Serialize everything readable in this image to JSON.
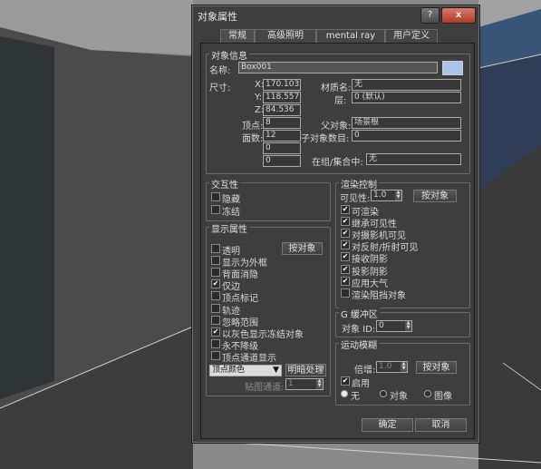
{
  "dialog": {
    "title": "对象属性",
    "help_label": "?",
    "close_label": "x"
  },
  "tabs": [
    "常规",
    "高级照明",
    "mental ray",
    "用户定义"
  ],
  "object_info": {
    "legend": "对象信息",
    "name_label": "名称:",
    "name_value": "Box001",
    "color": "#a9c3ec",
    "size_label": "尺寸:",
    "x_label": "X:",
    "x_value": "170.103",
    "y_label": "Y:",
    "y_value": "118.557",
    "z_label": "Z:",
    "z_value": "84.536",
    "material_label": "材质名:",
    "material_value": "无",
    "layer_label": "层:",
    "layer_value": "0 (默认)",
    "vertices_label": "顶点:",
    "vertices_value": "8",
    "faces_label": "面数:",
    "faces_value": "12",
    "extra_value_1": "0",
    "extra_value_2": "0",
    "parent_label": "父对象:",
    "parent_value": "场景根",
    "children_label": "子对象数目:",
    "children_value": "0",
    "group_label": "在组/集合中:",
    "group_value": "无"
  },
  "interactivity": {
    "legend": "交互性",
    "hide": "隐藏",
    "freeze": "冻结"
  },
  "display_props": {
    "legend": "显示属性",
    "by_object": "按对象",
    "items": [
      {
        "label": "透明",
        "checked": false
      },
      {
        "label": "显示为外框",
        "checked": false
      },
      {
        "label": "背面消隐",
        "checked": false
      },
      {
        "label": "仅边",
        "checked": true
      },
      {
        "label": "顶点标记",
        "checked": false
      },
      {
        "label": "轨迹",
        "checked": false
      },
      {
        "label": "忽略范围",
        "checked": false
      },
      {
        "label": "以灰色显示冻结对象",
        "checked": true
      },
      {
        "label": "永不降级",
        "checked": false
      },
      {
        "label": "顶点通道显示",
        "checked": false
      }
    ],
    "vertex_color": "顶点颜色",
    "shading": "明暗处理",
    "map_channel_label": "贴图通道:",
    "map_channel_value": "1"
  },
  "render_control": {
    "legend": "渲染控制",
    "visibility_label": "可见性:",
    "visibility_value": "1.0",
    "by_object": "按对象",
    "items": [
      {
        "label": "可渲染",
        "checked": true
      },
      {
        "label": "继承可见性",
        "checked": true
      },
      {
        "label": "对摄影机可见",
        "checked": true
      },
      {
        "label": "对反射/折射可见",
        "checked": true
      },
      {
        "label": "接收阴影",
        "checked": true
      },
      {
        "label": "投影阴影",
        "checked": true
      },
      {
        "label": "应用大气",
        "checked": true
      },
      {
        "label": "渲染阻挡对象",
        "checked": false
      }
    ]
  },
  "gbuffer": {
    "legend": "G 缓冲区",
    "object_id_label": "对象 ID:",
    "object_id_value": "0"
  },
  "motion_blur": {
    "legend": "运动模糊",
    "multiplier_label": "倍增:",
    "multiplier_value": "1.0",
    "by_object": "按对象",
    "enable": "启用",
    "enable_checked": true,
    "options": [
      {
        "label": "无",
        "selected": true
      },
      {
        "label": "对象",
        "selected": false
      },
      {
        "label": "图像",
        "selected": false
      }
    ]
  },
  "footer": {
    "ok": "确定",
    "cancel": "取消"
  }
}
